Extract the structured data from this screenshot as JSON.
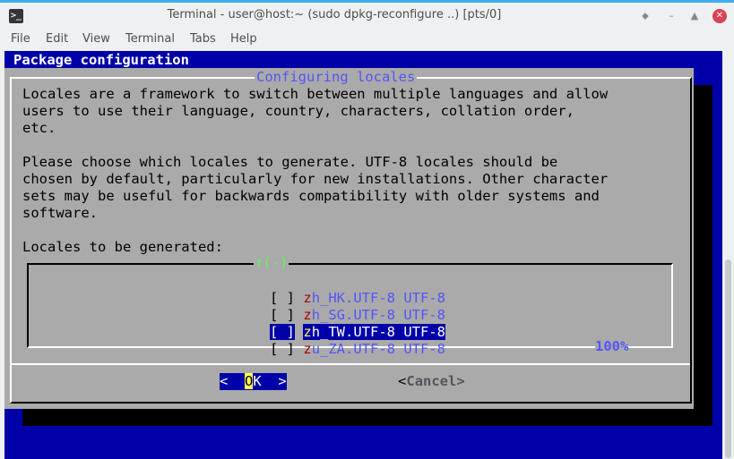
{
  "window": {
    "title": "Terminal - user@host:~ (sudo dpkg-reconfigure ..) [pts/0]",
    "app_icon_glyph": ">_",
    "buttons": {
      "minimize": "–",
      "restore": "⬥",
      "maximize": "▲",
      "close": "✕"
    }
  },
  "menu": [
    "File",
    "Edit",
    "View",
    "Terminal",
    "Tabs",
    "Help"
  ],
  "terminal": {
    "header": "Package configuration",
    "dialog": {
      "title": "Configuring locales",
      "paragraphs": [
        "Locales are a framework to switch between multiple languages and allow",
        "users to use their language, country, characters, collation order,",
        "etc.",
        "",
        "Please choose which locales to generate. UTF-8 locales should be",
        "chosen by default, particularly for new installations. Other character",
        "sets may be useful for backwards compatibility with older systems and",
        "software."
      ],
      "list_label": "Locales to be generated:",
      "scroll_indicator": "↑(-)",
      "percent": "100%",
      "items": [
        {
          "checkbox": "[ ]",
          "hotkey": "z",
          "name": "h_HK.UTF-8 UTF-8",
          "selected": false
        },
        {
          "checkbox": "[ ]",
          "hotkey": "z",
          "name": "h_SG.UTF-8 UTF-8",
          "selected": false
        },
        {
          "checkbox": "[ ]",
          "hotkey": "z",
          "name": "h_TW.UTF-8 UTF-8",
          "selected": true
        },
        {
          "checkbox": "[ ]",
          "hotkey": "z",
          "name": "u_ZA.UTF-8 UTF-8",
          "selected": false
        }
      ],
      "ok_button": {
        "left": "<  ",
        "hot": "O",
        "rest": "K  >"
      },
      "cancel_button": {
        "left": "<",
        "hot": "C",
        "rest": "ancel>"
      }
    }
  },
  "colors": {
    "terminal_bg": "#0000a8",
    "dialog_bg": "#aaaaaa",
    "accent_blue": "#5454fc",
    "hotkey_red": "#a80000",
    "highlight_yellow": "#ffff54",
    "scroll_green": "#54fc54"
  }
}
